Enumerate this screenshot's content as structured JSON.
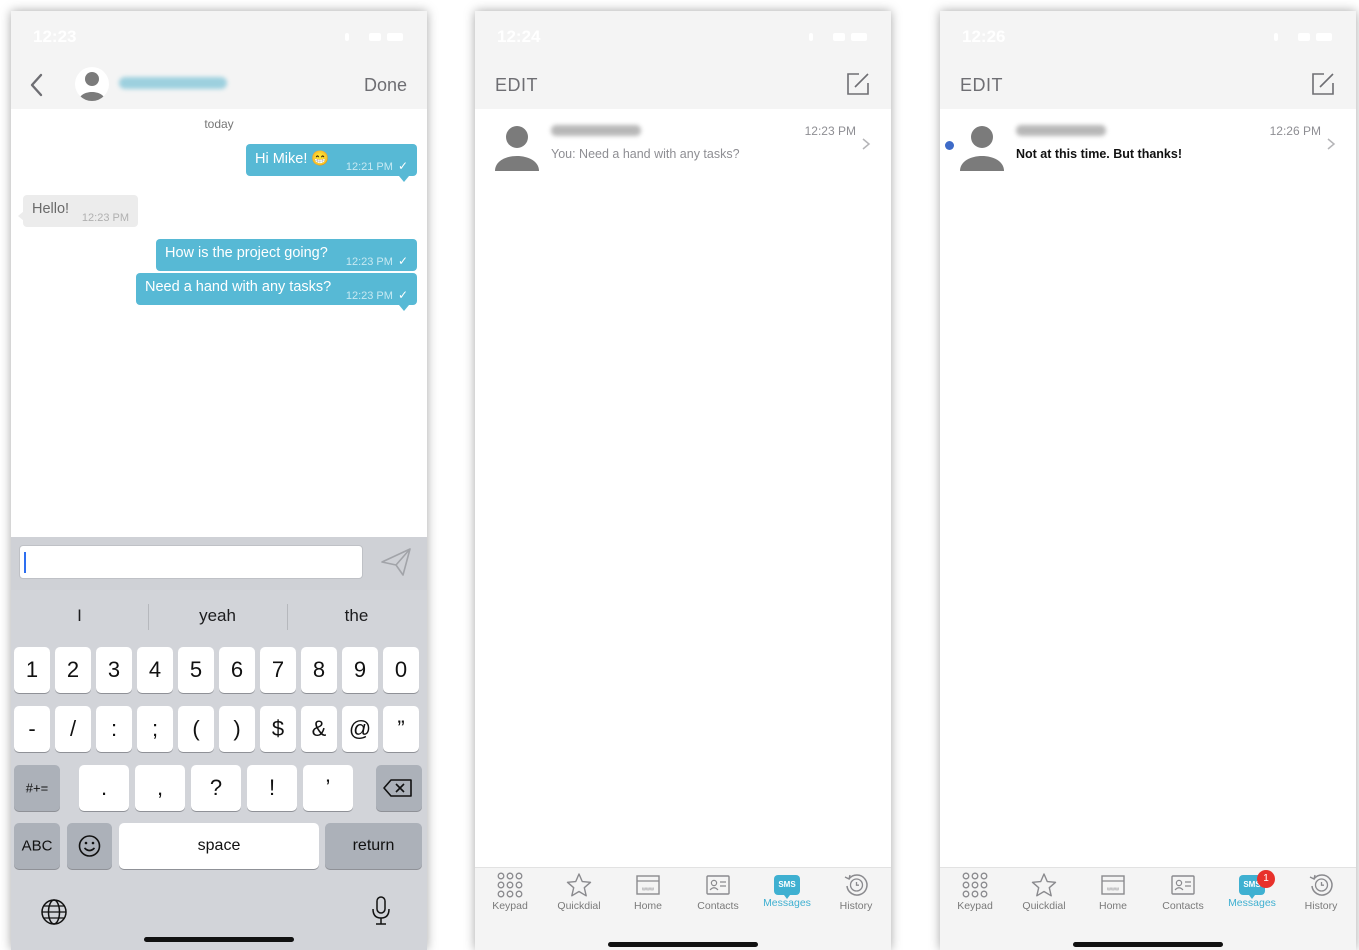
{
  "screens": [
    {
      "status": {
        "time": "12:23"
      },
      "nav": {
        "done_label": "Done"
      },
      "chat": {
        "date_label": "today",
        "messages": [
          {
            "direction": "out",
            "text": "Hi Mike! 😁",
            "time": "12:21 PM"
          },
          {
            "direction": "in",
            "text": "Hello!",
            "time": "12:23 PM"
          },
          {
            "direction": "out",
            "text": "How is the project going?",
            "time": "12:23 PM"
          },
          {
            "direction": "out",
            "text": "Need a hand with any tasks?",
            "time": "12:23 PM"
          }
        ]
      },
      "keyboard": {
        "suggestions": [
          "I",
          "yeah",
          "the"
        ],
        "row1": [
          "1",
          "2",
          "3",
          "4",
          "5",
          "6",
          "7",
          "8",
          "9",
          "0"
        ],
        "row2": [
          "-",
          "/",
          ":",
          ";",
          "(",
          ")",
          "$",
          "&",
          "@",
          "”"
        ],
        "row3": [
          ".",
          ",",
          "?",
          "!",
          "’"
        ],
        "symbols_key": "#+=",
        "abc_key": "ABC",
        "space_key": "space",
        "return_key": "return"
      }
    },
    {
      "status": {
        "time": "12:24"
      },
      "nav": {
        "edit_label": "EDIT"
      },
      "conversation": {
        "time": "12:23 PM",
        "preview": "You: Need a hand with any tasks?"
      }
    },
    {
      "status": {
        "time": "12:26"
      },
      "nav": {
        "edit_label": "EDIT"
      },
      "conversation": {
        "time": "12:26 PM",
        "preview": "Not at this time. But thanks!"
      },
      "messages_badge": "1"
    }
  ],
  "tabs": [
    "Keypad",
    "Quickdial",
    "Home",
    "Contacts",
    "Messages",
    "History"
  ],
  "sms_icon_text": "SMS",
  "colors": {
    "accent": "#57b9d5",
    "tab_active": "#3fb0d1",
    "badge": "#e8312b",
    "unread": "#3e6bc8"
  }
}
